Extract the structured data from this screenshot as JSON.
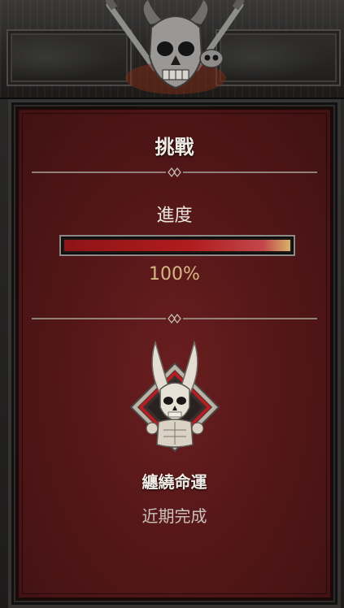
{
  "panel": {
    "title": "挑戰",
    "progress_label": "進度",
    "progress_value": "100%",
    "progress_fraction": 1.0,
    "reward_name": "纏繞命運",
    "reward_status": "近期完成"
  },
  "colors": {
    "panel_bg": "#551718",
    "bar_fill": "#b01c1d",
    "value_text": "#d6b782",
    "title_text": "#f0ece5"
  },
  "icons": {
    "header": "skull-crossed-swords-icon",
    "reward": "horned-skull-emblem-icon"
  }
}
